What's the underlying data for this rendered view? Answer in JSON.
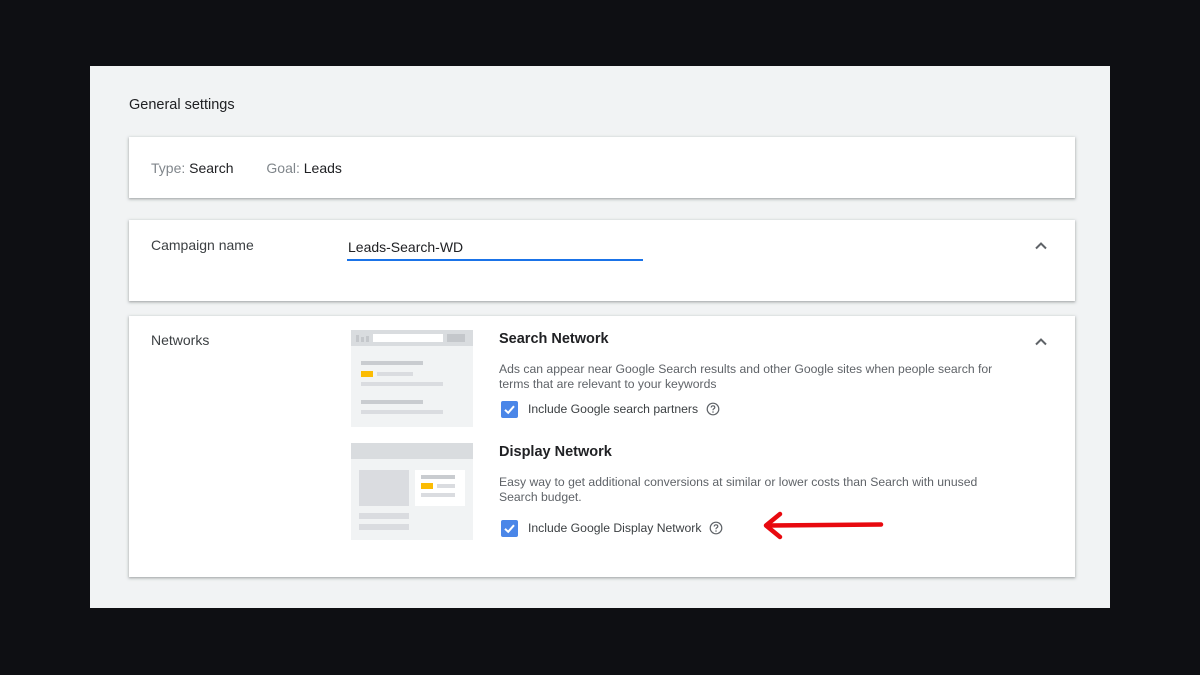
{
  "general_settings": {
    "title": "General settings",
    "type_label": "Type:",
    "type_value": "Search",
    "goal_label": "Goal:",
    "goal_value": "Leads"
  },
  "campaign_name": {
    "label": "Campaign name",
    "value": "Leads-Search-WD",
    "collapse_icon": "chevron-up-icon"
  },
  "networks": {
    "label": "Networks",
    "collapse_icon": "chevron-up-icon",
    "search": {
      "title": "Search Network",
      "description": "Ads can appear near Google Search results and other Google sites when people search for terms that are relevant to your keywords",
      "checkbox_label": "Include Google search partners",
      "checked": true,
      "help_icon": "help-circle-icon"
    },
    "display": {
      "title": "Display Network",
      "description": "Easy way to get additional conversions at similar or lower costs than Search with unused Search budget.",
      "checkbox_label": "Include Google Display Network",
      "checked": true,
      "help_icon": "help-circle-icon"
    }
  },
  "colors": {
    "accent_blue": "#1a73e8",
    "checkbox_blue": "#4a86e8",
    "annotation_red": "#e8090f",
    "illustration_yellow": "#fbbc04"
  }
}
